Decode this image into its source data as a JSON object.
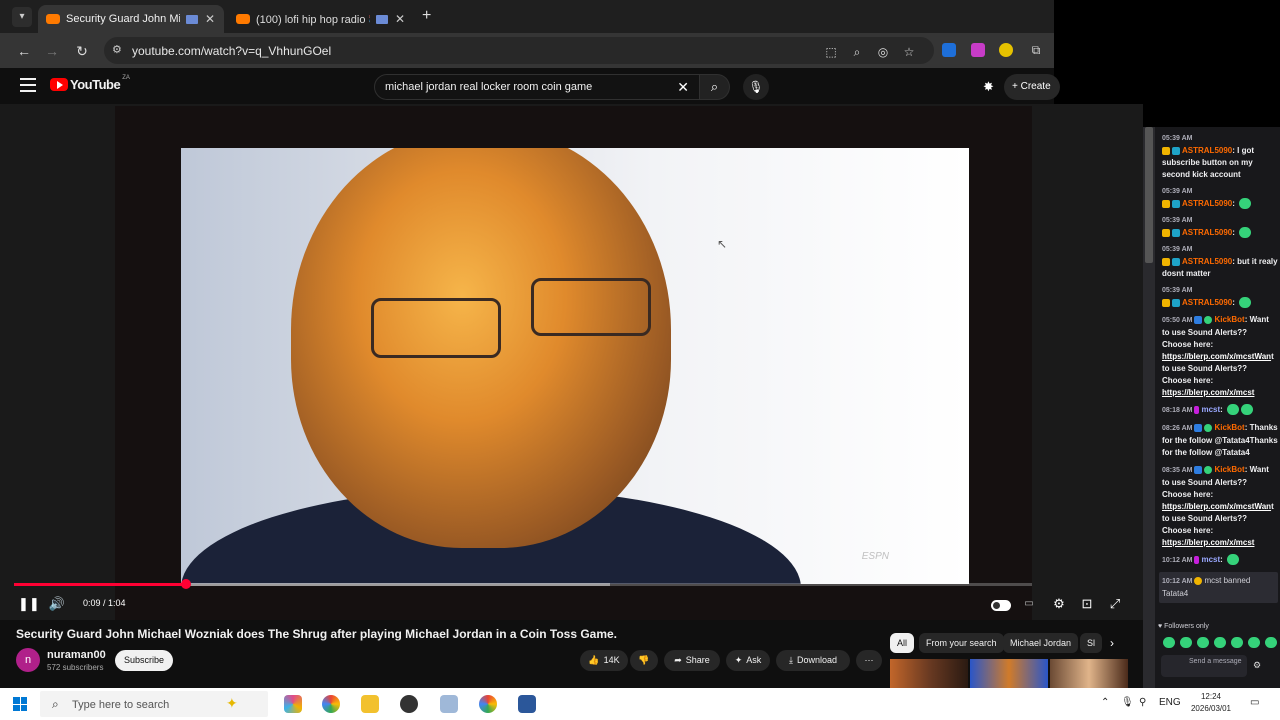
{
  "browser": {
    "tabs": [
      {
        "title": "Security Guard John Micha",
        "active": true
      },
      {
        "title": "(100) lofi hip hop radio 📚",
        "active": false
      }
    ],
    "url": "youtube.com/watch?v=q_VhhunGOel"
  },
  "youtube": {
    "logo_text": "YouTube",
    "country_code": "ZA",
    "search_query": "michael jordan real locker room coin game",
    "create_label": "Create"
  },
  "player": {
    "current_time": "0:09",
    "duration": "1:04",
    "time_display": "0:09 / 1:04",
    "played_fraction": 0.169,
    "buffered_fraction": 0.585,
    "watermark": "ESPN"
  },
  "video": {
    "title": "Security Guard John Michael Wozniak does The Shrug after playing Michael Jordan in a Coin Toss Game.",
    "channel_name": "nuraman00",
    "channel_initial": "n",
    "subscribers": "572 subscribers",
    "subscribe_label": "Subscribe",
    "likes": "14K",
    "share_label": "Share",
    "ask_label": "Ask",
    "download_label": "Download"
  },
  "chips": [
    "All",
    "From your search",
    "Michael Jordan",
    "Sl"
  ],
  "chat": {
    "messages": [
      {
        "time": "05:39 AM",
        "user": "ASTRAL5090",
        "text": "I got subscribe button on my second kick account"
      },
      {
        "time": "05:39 AM",
        "user": "ASTRAL5090",
        "text": ""
      },
      {
        "time": "05:39 AM",
        "user": "ASTRAL5090",
        "text": ""
      },
      {
        "time": "05:39 AM",
        "user": "ASTRAL5090",
        "text": "but it realy dosnt matter"
      },
      {
        "time": "05:39 AM",
        "user": "ASTRAL5090",
        "text": ""
      }
    ],
    "bot1": {
      "time": "05:50 AM",
      "user": "KickBot",
      "text": "Want to use Sound Alerts?? Choose here:",
      "link1": "https://blerp.com/x/mcstWan",
      "text2": "t to use Sound Alerts?? Choose here:",
      "link2": "https://blerp.com/x/mcst"
    },
    "mcst1": {
      "time": "08:18 AM",
      "user": "mcst"
    },
    "bot2": {
      "time": "08:26 AM",
      "user": "KickBot",
      "text": "Thanks for the follow @Tatata4Thanks for the follow @Tatata4"
    },
    "bot3": {
      "time": "08:35 AM",
      "user": "KickBot",
      "text": "Want to use Sound Alerts?? Choose here:",
      "link1": "https://blerp.com/x/mcstWan",
      "text2": "t to use Sound Alerts?? Choose here:",
      "link2": "https://blerp.com/x/mcst"
    },
    "mcst2": {
      "time": "10:12 AM",
      "user": "mcst"
    },
    "ban": {
      "time": "10:12 AM",
      "text": "mcst banned Tatata4"
    },
    "followers_only": "Followers only",
    "input_placeholder": "Send a message"
  },
  "taskbar": {
    "search_placeholder": "Type here to search",
    "language": "ENG",
    "time": "12:24",
    "date": "2026/03/01"
  },
  "colors": {
    "yt_red": "#ff0000",
    "progress_red": "#ff0033",
    "kick_green": "#35d27a",
    "chat_user_orange": "#ff6a00"
  }
}
